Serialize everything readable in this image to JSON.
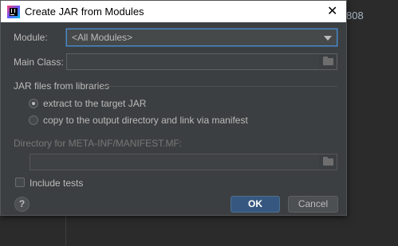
{
  "background": {
    "ide_text": "808"
  },
  "dialog": {
    "title": "Create JAR from Modules",
    "close_glyph": "✕",
    "module_label": "Module:",
    "module_value": "<All Modules>",
    "main_class_label": "Main Class:",
    "main_class_value": "",
    "libraries_group_title": "JAR files from libraries",
    "option_extract": "extract to the target JAR",
    "option_copy": "copy to the output directory and link via manifest",
    "selected_option": "extract",
    "manifest_dir_label": "Directory for META-INF/MANIFEST.MF:",
    "manifest_dir_value": "",
    "include_tests_label": "Include tests",
    "include_tests_checked": false,
    "help_glyph": "?",
    "ok_label": "OK",
    "cancel_label": "Cancel"
  },
  "icons": [
    "app-icon",
    "close-icon",
    "dropdown-arrow-icon",
    "folder-icon",
    "help-icon"
  ],
  "colors": {
    "dialog_bg": "#3c3f41",
    "accent_focus": "#4a88c7",
    "ok_button": "#365880",
    "text": "#bbbbbb",
    "disabled_text": "#777777"
  }
}
